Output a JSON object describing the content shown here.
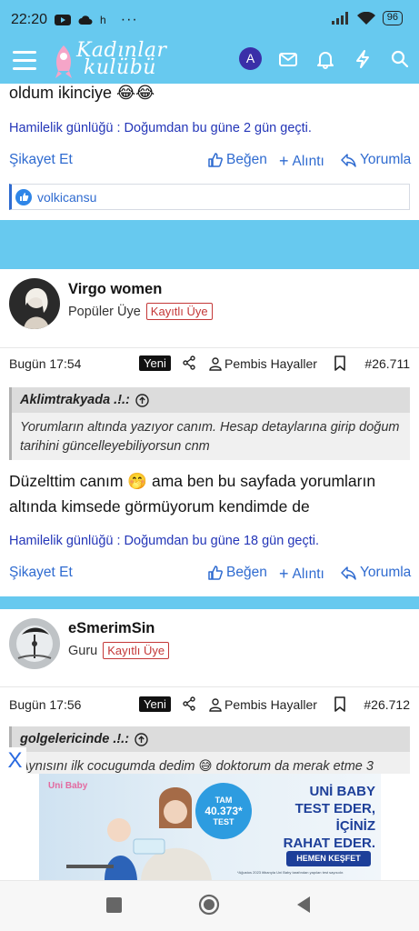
{
  "status_bar": {
    "time": "22:20",
    "battery": "96",
    "extra": "h"
  },
  "app_bar": {
    "logo_line1": "Kadınlar",
    "logo_line2": "kulübü",
    "avatar_letter": "A"
  },
  "prev_post": {
    "text_tail": "oldum ikinciye 😂😂",
    "signature": "Hamilelik günlüğü : Doğumdan bu güne 2 gün geçti.",
    "report": "Şikayet Et",
    "like": "Beğen",
    "quote": "Alıntı",
    "reply": "Yorumla",
    "liked_by": "volkicansu"
  },
  "post1": {
    "username": "Virgo women",
    "role": "Popüler Üye",
    "badge": "Kayıtlı Üye",
    "time": "Bugün 17:54",
    "new_label": "Yeni",
    "thread_author": "Pembis Hayaller",
    "post_number": "#26.711",
    "quote_author": "Aklimtrakyada .!.:",
    "quote_text": "Yorumların altında yazıyor canım. Hesap detaylarına girip doğum tarihini güncelleyebiliyorsun cnm",
    "body": "Düzelttim canım 🤭 ama ben bu sayfada yorumların altında kimsede görmüyorum kendimde de",
    "signature": "Hamilelik günlüğü : Doğumdan bu güne 18 gün geçti.",
    "report": "Şikayet Et",
    "like": "Beğen",
    "quote": "Alıntı",
    "reply": "Yorumla"
  },
  "post2": {
    "username": "eSmerimSin",
    "role": "Guru",
    "badge": "Kayıtlı Üye",
    "time": "Bugün 17:56",
    "new_label": "Yeni",
    "thread_author": "Pembis Hayaller",
    "post_number": "#26.712",
    "quote_author": "golgelericinde .!.:",
    "quote_text": "Aynısını ilk cocugumda dedim 😅 doktorum da merak etme 3"
  },
  "ad": {
    "close_label": "X",
    "brand": "Uni Baby",
    "badge_line1": "TAM",
    "badge_line2": "40.373*",
    "badge_line3": "TEST",
    "headline1": "UNİ BABY",
    "headline2": "TEST EDER,",
    "headline3": "İÇİNİZ",
    "headline4": "RAHAT EDER.",
    "cta": "HEMEN KEŞFET",
    "fineprint": "*Ağustos 2023 itibarıyla Uni Baby tarafından yapılan test sayısıdır.",
    "colors": {
      "brand_blue": "#1d3f99",
      "badge_blue": "#2d9ce0"
    }
  },
  "theme": {
    "accent": "#67c9ef",
    "link": "#2f6bd0",
    "signature": "#2436b8",
    "badge_red": "#c43838"
  }
}
